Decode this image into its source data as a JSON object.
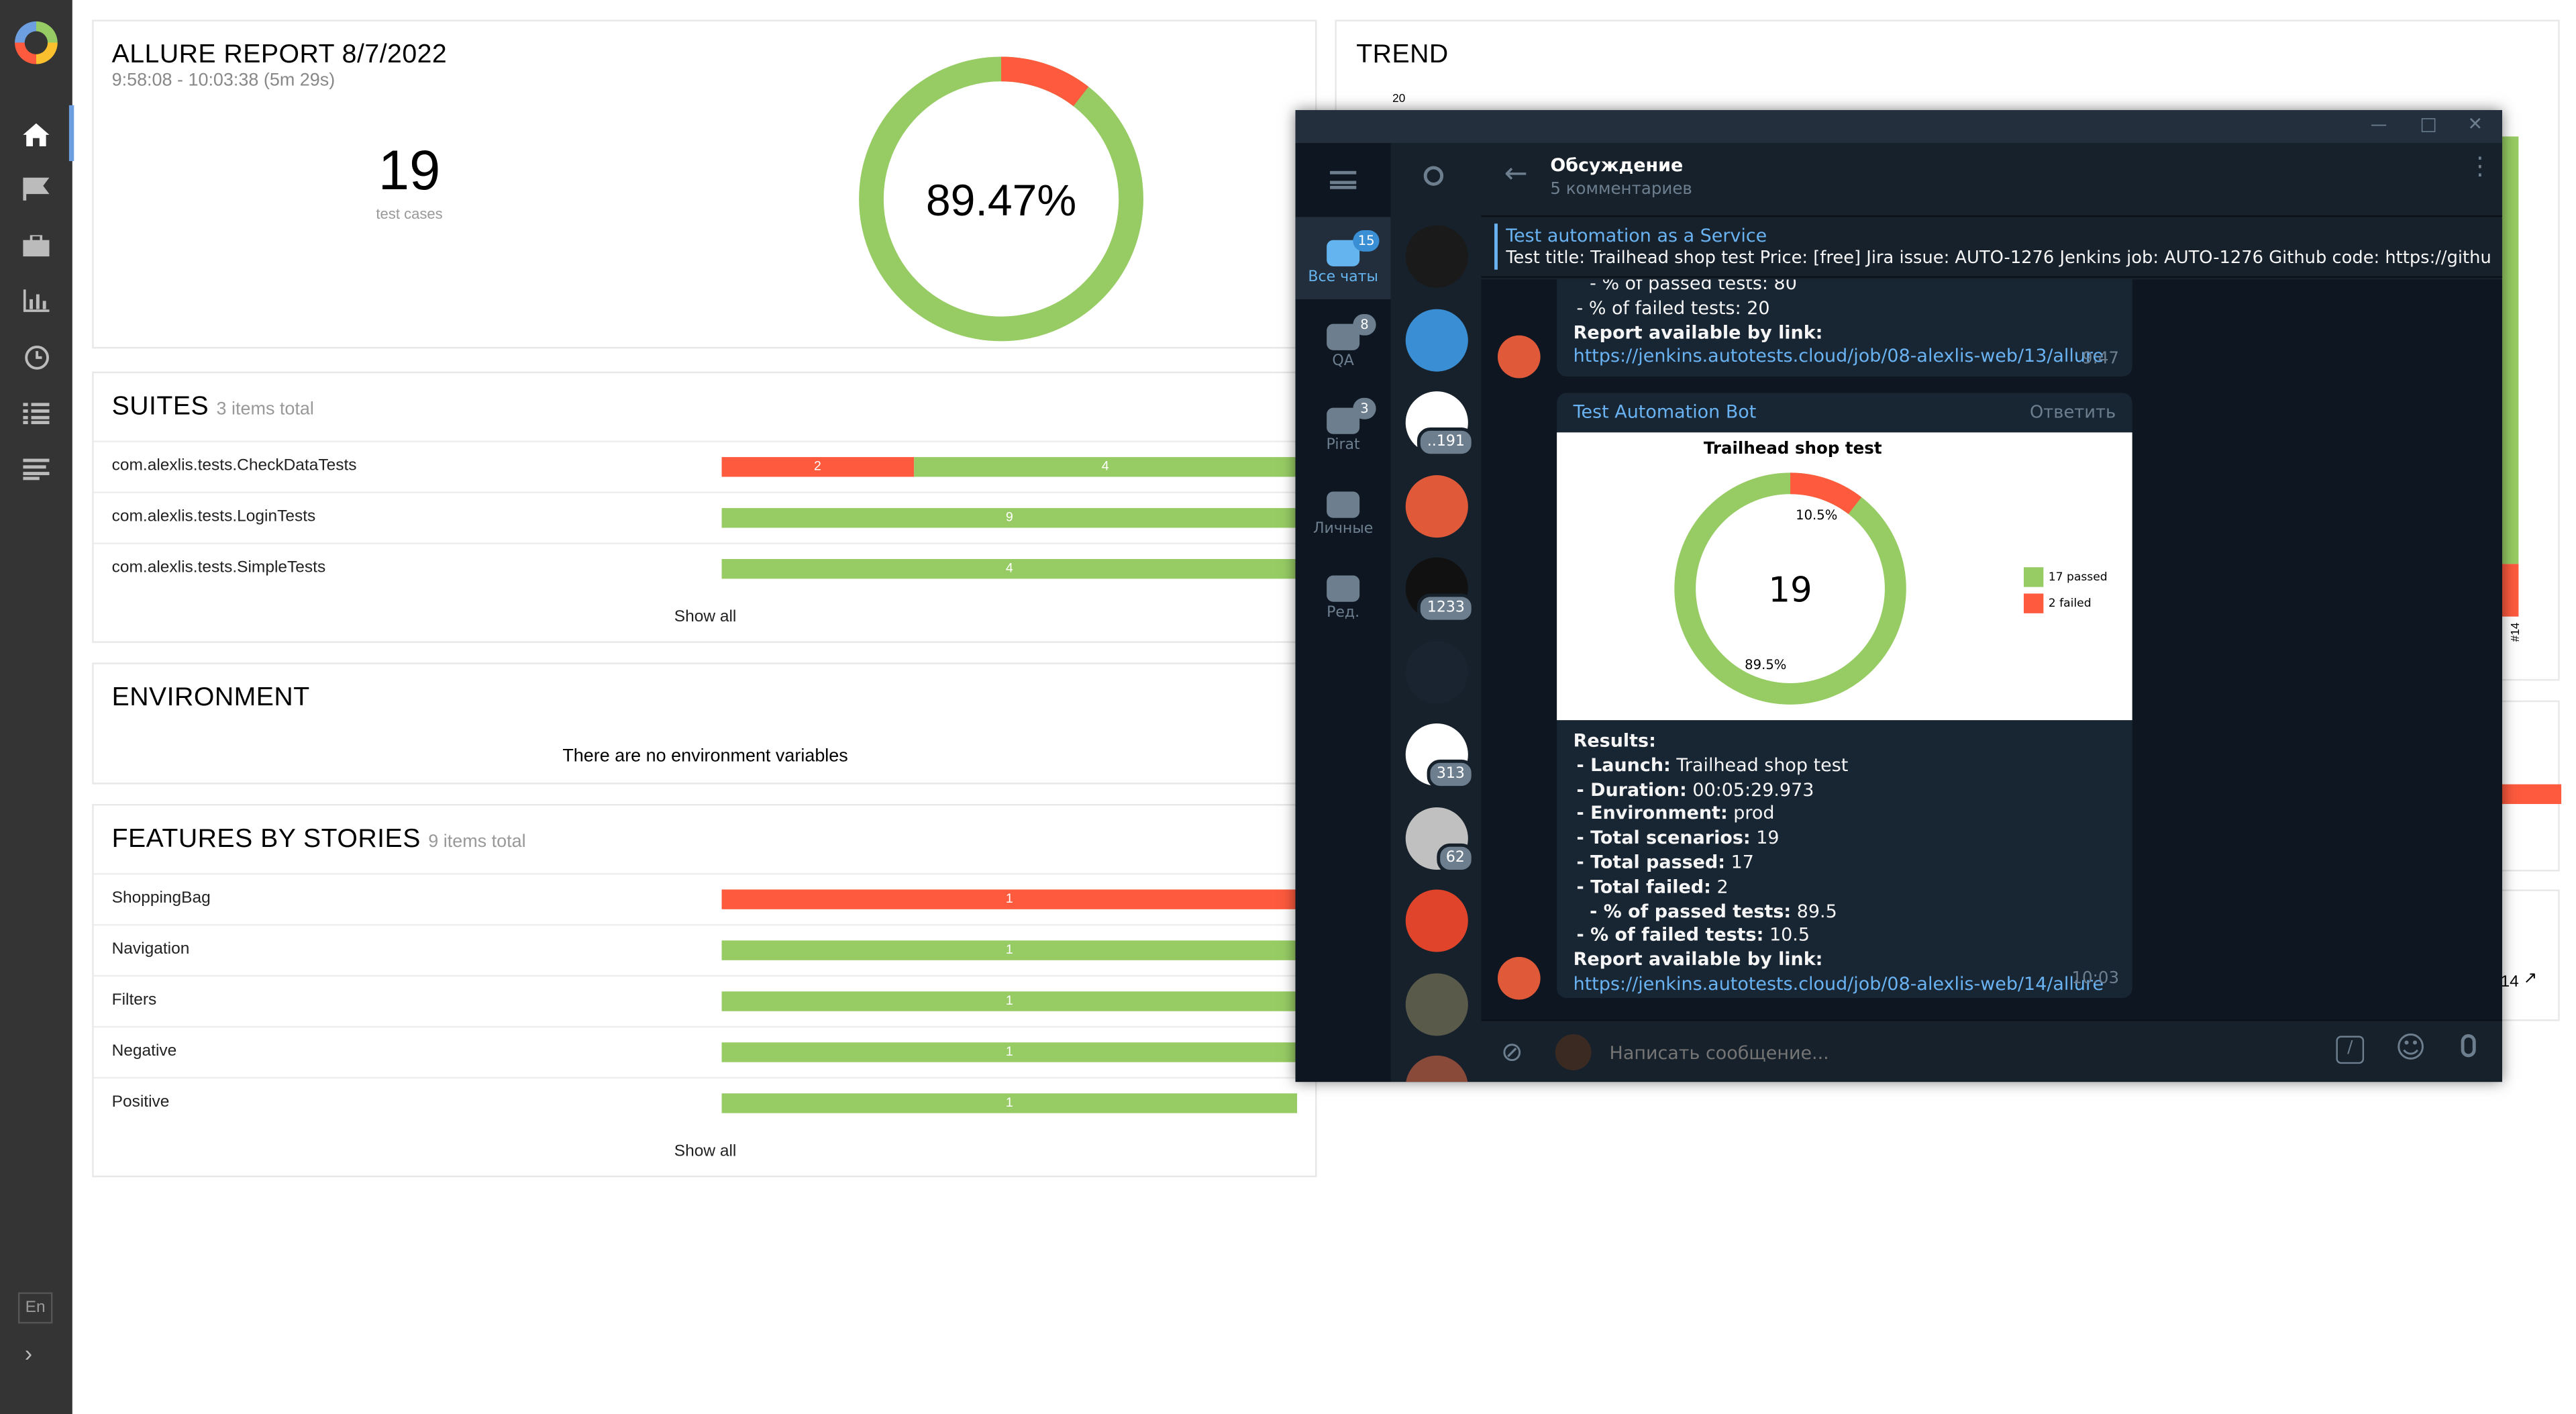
{
  "sidebar": {
    "lang": "En",
    "items": [
      "home-icon",
      "flag-icon",
      "briefcase-icon",
      "chart-icon",
      "clock-icon",
      "list-icon",
      "lines-icon"
    ]
  },
  "summary": {
    "title": "ALLURE REPORT 8/7/2022",
    "time": "9:58:08 - 10:03:38 (5m 29s)",
    "count": "19",
    "count_label": "test cases",
    "percent": "89.47%",
    "pass_fraction": 0.8947,
    "colors": {
      "passed": "#97cc64",
      "failed": "#fd5a3e"
    }
  },
  "trend": {
    "title": "TREND",
    "ytick": "20",
    "xtick": "#14"
  },
  "suites": {
    "title": "SUITES",
    "total": "3 items total",
    "show_all": "Show all",
    "rows": [
      {
        "name": "com.alexlis.tests.CheckDataTests",
        "failed": "2",
        "passed": "4",
        "failed_n": 2,
        "passed_n": 4
      },
      {
        "name": "com.alexlis.tests.LoginTests",
        "failed": "",
        "passed": "9",
        "failed_n": 0,
        "passed_n": 9
      },
      {
        "name": "com.alexlis.tests.SimpleTests",
        "failed": "",
        "passed": "4",
        "failed_n": 0,
        "passed_n": 4
      }
    ]
  },
  "environment": {
    "title": "ENVIRONMENT",
    "empty": "There are no environment variables"
  },
  "features": {
    "title": "FEATURES BY STORIES",
    "total": "9 items total",
    "show_all": "Show all",
    "rows": [
      {
        "name": "ShoppingBag",
        "failed": "1",
        "passed": "",
        "failed_n": 1,
        "passed_n": 0
      },
      {
        "name": "Navigation",
        "failed": "",
        "passed": "1",
        "failed_n": 0,
        "passed_n": 1
      },
      {
        "name": "Filters",
        "failed": "",
        "passed": "1",
        "failed_n": 0,
        "passed_n": 1
      },
      {
        "name": "Negative",
        "failed": "",
        "passed": "1",
        "failed_n": 0,
        "passed_n": 1
      },
      {
        "name": "Positive",
        "failed": "",
        "passed": "1",
        "failed_n": 0,
        "passed_n": 1
      }
    ]
  },
  "right_partial": {
    "link": "14"
  },
  "telegram": {
    "folders": [
      {
        "label": "Все чаты",
        "badge": "15",
        "icon": "chats-icon"
      },
      {
        "label": "QA",
        "badge": "8",
        "icon": "qa-folder-icon"
      },
      {
        "label": "Pirat",
        "badge": "3",
        "icon": "pirat-folder-icon"
      },
      {
        "label": "Личные",
        "badge": "",
        "icon": "folder-icon"
      },
      {
        "label": "Ред.",
        "badge": "",
        "icon": "edit-folders-icon"
      }
    ],
    "chats": [
      {
        "badge": "",
        "color": "#1a1a1a"
      },
      {
        "badge": "",
        "color": "#3a8fd4"
      },
      {
        "badge": "..191",
        "color": "#ffffff"
      },
      {
        "badge": "",
        "color": "#e05a3a"
      },
      {
        "badge": "1233",
        "color": "#111111"
      },
      {
        "badge": "",
        "color": "#1a2330"
      },
      {
        "badge": "313",
        "color": "#ffffff"
      },
      {
        "badge": "62",
        "color": "#c0c0c0"
      },
      {
        "badge": "",
        "color": "#e0442a"
      },
      {
        "badge": "",
        "color": "#5a5a4a"
      },
      {
        "badge": "",
        "color": "#8a4a3a"
      }
    ],
    "header": {
      "title": "Обсуждение",
      "subtitle": "5 комментариев"
    },
    "pinned": {
      "title": "Test automation as a Service",
      "text": "Test title: Trailhead shop test Price: [free] Jira issue: AUTO-1276 Jenkins job: AUTO-1276 Github code: https://github.co..."
    },
    "msg1": {
      "line1": "- % of passed tests: 80",
      "line2": "- % of failed tests: 20",
      "report_label": "Report available by link:",
      "link": "https://jenkins.autotests.cloud/job/08-alexlis-web/13/allure",
      "time": "9:47"
    },
    "msg2": {
      "sender": "Test Automation Bot",
      "reply": "Ответить",
      "chart_title": "Trailhead shop test",
      "total": "19",
      "failed_pct": "10.5%",
      "passed_pct": "89.5%",
      "legend_passed": "17 passed",
      "legend_failed": "2 failed",
      "results_label": "Results:",
      "lines": [
        [
          "- Launch:",
          "Trailhead shop test"
        ],
        [
          "- Duration:",
          "00:05:29.973"
        ],
        [
          "- Environment:",
          "prod"
        ],
        [
          "- Total scenarios:",
          "19"
        ],
        [
          "- Total passed:",
          "17"
        ],
        [
          "- Total failed:",
          "2"
        ],
        [
          "- % of passed tests:",
          "89.5"
        ],
        [
          "- % of failed tests:",
          "10.5"
        ]
      ],
      "report_label": "Report available by link:",
      "link": "https://jenkins.autotests.cloud/job/08-alexlis-web/14/allure",
      "time": "10:03"
    },
    "input": {
      "placeholder": "Написать сообщение..."
    }
  },
  "chart_data": [
    {
      "type": "pie",
      "title": "",
      "values": [
        {
          "label": "passed",
          "value": 89.47
        },
        {
          "label": "failed",
          "value": 10.53
        }
      ],
      "center_label": "89.47%"
    },
    {
      "type": "pie",
      "title": "Trailhead shop test",
      "values": [
        {
          "label": "17 passed",
          "value": 17
        },
        {
          "label": "2 failed",
          "value": 2
        }
      ],
      "center_label": "19",
      "slice_labels": [
        "89.5%",
        "10.5%"
      ]
    }
  ]
}
